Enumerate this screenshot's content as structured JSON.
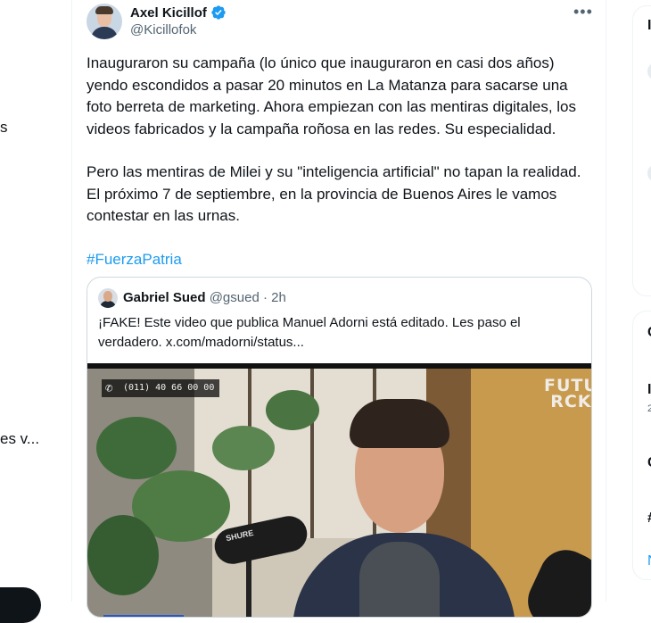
{
  "left_column": {
    "fragments": [
      "s",
      "es v..."
    ]
  },
  "tweet": {
    "author_name": "Axel Kicillof",
    "handle": "@Kicillofok",
    "more_label": "•••",
    "paragraphs": [
      "Inauguraron su campaña (lo único que inauguraron en casi dos años) yendo escondidos a pasar 20 minutos en La Matanza para sacarse una foto berreta de marketing. Ahora empiezan con las mentiras digitales, los videos fabricados y la campaña roñosa en las redes. Su especialidad.",
      "Pero las mentiras de Milei y su \"inteligencia artificial\" no tapan la realidad. El próximo 7 de septiembre, en la provincia de Buenos Aires le vamos contestar en las urnas."
    ],
    "hashtag": "#FuerzaPatria",
    "colors": {
      "link": "#1d9bf0",
      "verified": "#1d9bf0",
      "secondary_text": "#536471"
    }
  },
  "quote": {
    "author_name": "Gabriel Sued",
    "handle": "@gsued",
    "separator": "·",
    "time": "2h",
    "text": "¡FAKE! Este video que publica Manuel Adorni está editado. Les paso el verdadero.  x.com/madorni/status...",
    "media": {
      "phone_overlay": "(011) 40 66 00 00",
      "logo_line1": "FUTU",
      "logo_line2": "RCK",
      "mic_brand": "SHURE"
    }
  },
  "right_column": {
    "fragments": [
      "I",
      "C",
      "I",
      "2",
      "C",
      "#",
      "N"
    ]
  }
}
